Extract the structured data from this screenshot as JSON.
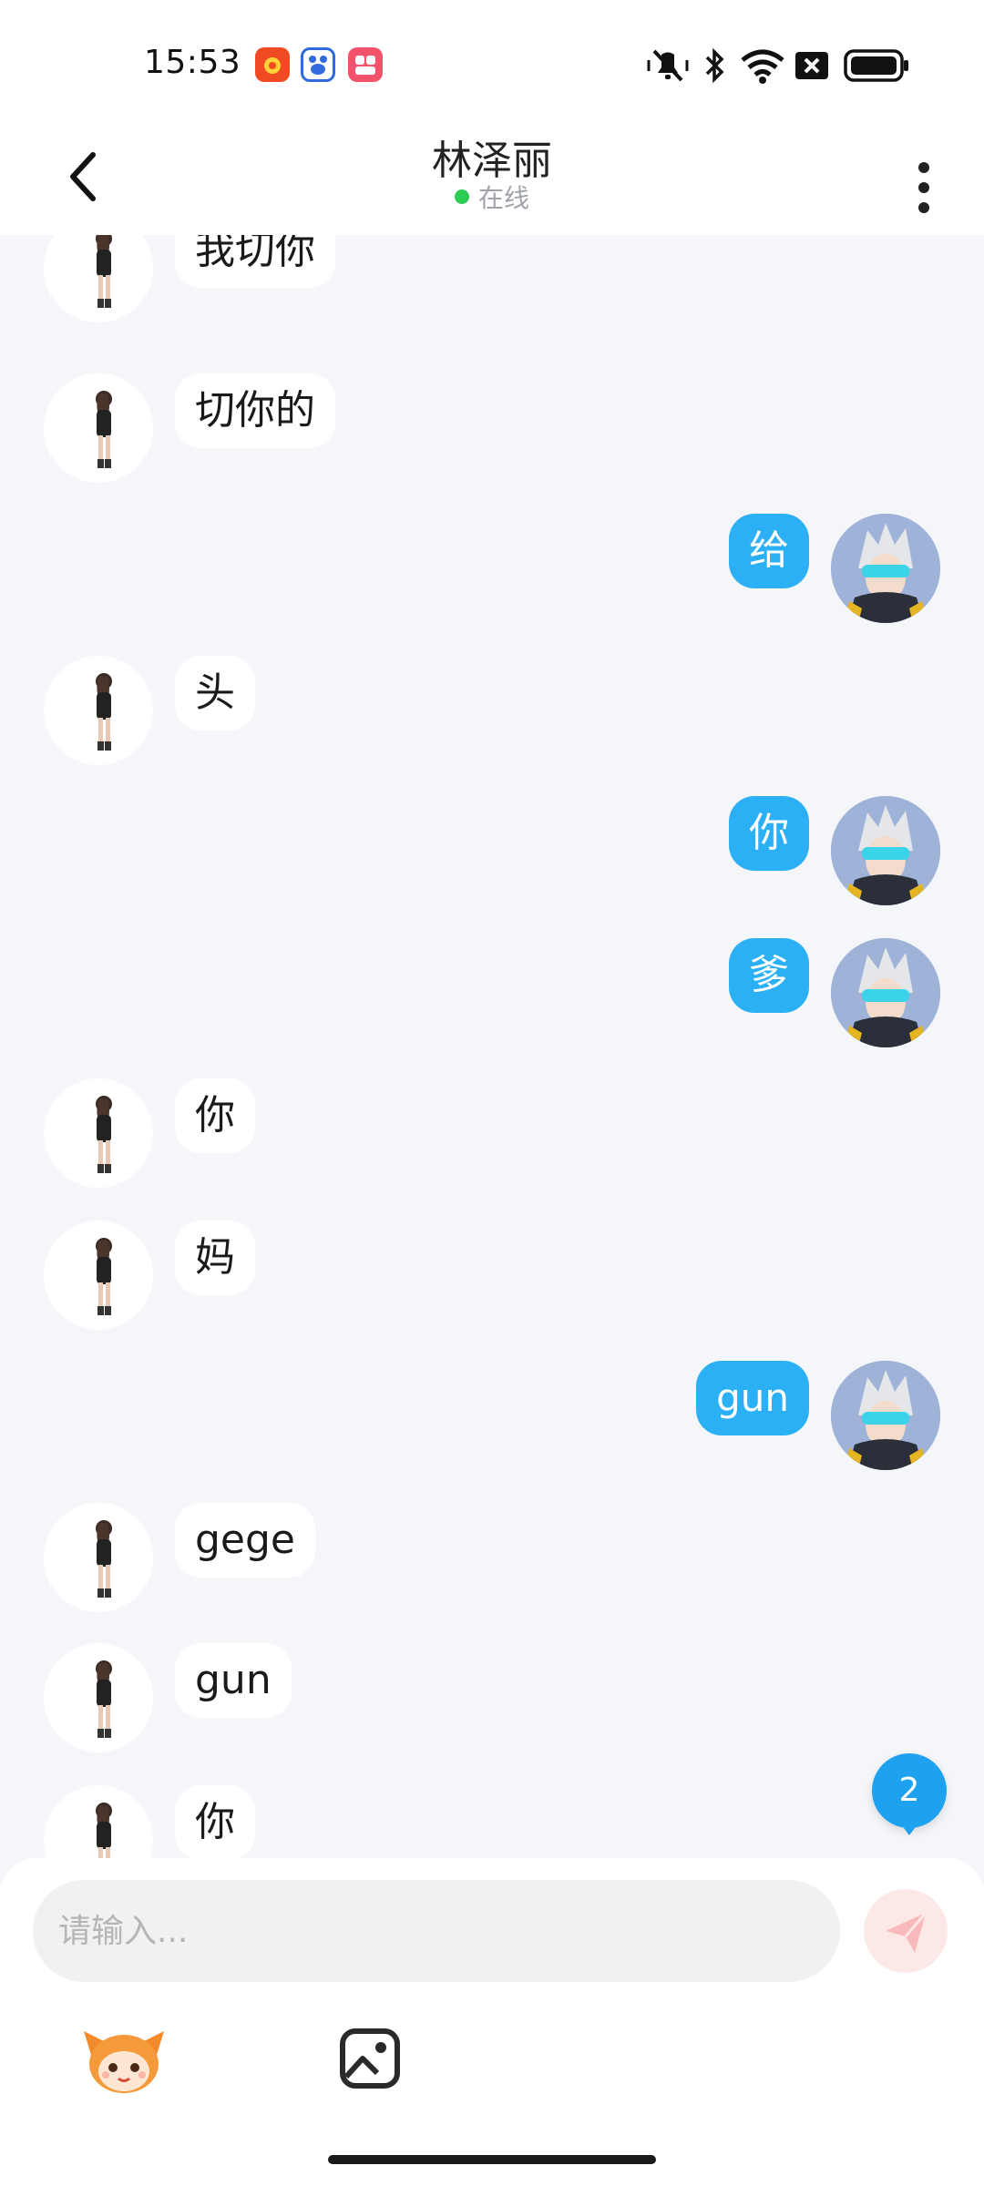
{
  "status_bar": {
    "time": "15:53",
    "left_icons": [
      "weibo-app-icon",
      "baidu-app-icon",
      "video-app-icon"
    ],
    "right_icons": [
      "silent-icon",
      "bluetooth-icon",
      "wifi-icon",
      "sim-off-icon",
      "battery-icon"
    ]
  },
  "header": {
    "title": "林泽丽",
    "status_text": "在线",
    "status_color": "#2ecc52"
  },
  "messages": [
    {
      "side": "left",
      "text": "我切你"
    },
    {
      "side": "left",
      "text": "切你的"
    },
    {
      "side": "right",
      "text": "给"
    },
    {
      "side": "left",
      "text": "头"
    },
    {
      "side": "right",
      "text": "你"
    },
    {
      "side": "right",
      "text": "爹"
    },
    {
      "side": "left",
      "text": "你"
    },
    {
      "side": "left",
      "text": "妈"
    },
    {
      "side": "right",
      "text": "gun"
    },
    {
      "side": "left",
      "text": "gege"
    },
    {
      "side": "left",
      "text": "gun"
    },
    {
      "side": "left",
      "text": "你"
    }
  ],
  "unread_badge": "2",
  "composer": {
    "placeholder": "请输入...",
    "send_icon": "send-icon",
    "tools": [
      "emoji-mascot-icon",
      "image-icon"
    ]
  },
  "colors": {
    "outgoing_bubble": "#2bb0f5",
    "incoming_bubble": "#ffffff",
    "badge": "#1ea1ef",
    "background": "#f4f6f9"
  }
}
